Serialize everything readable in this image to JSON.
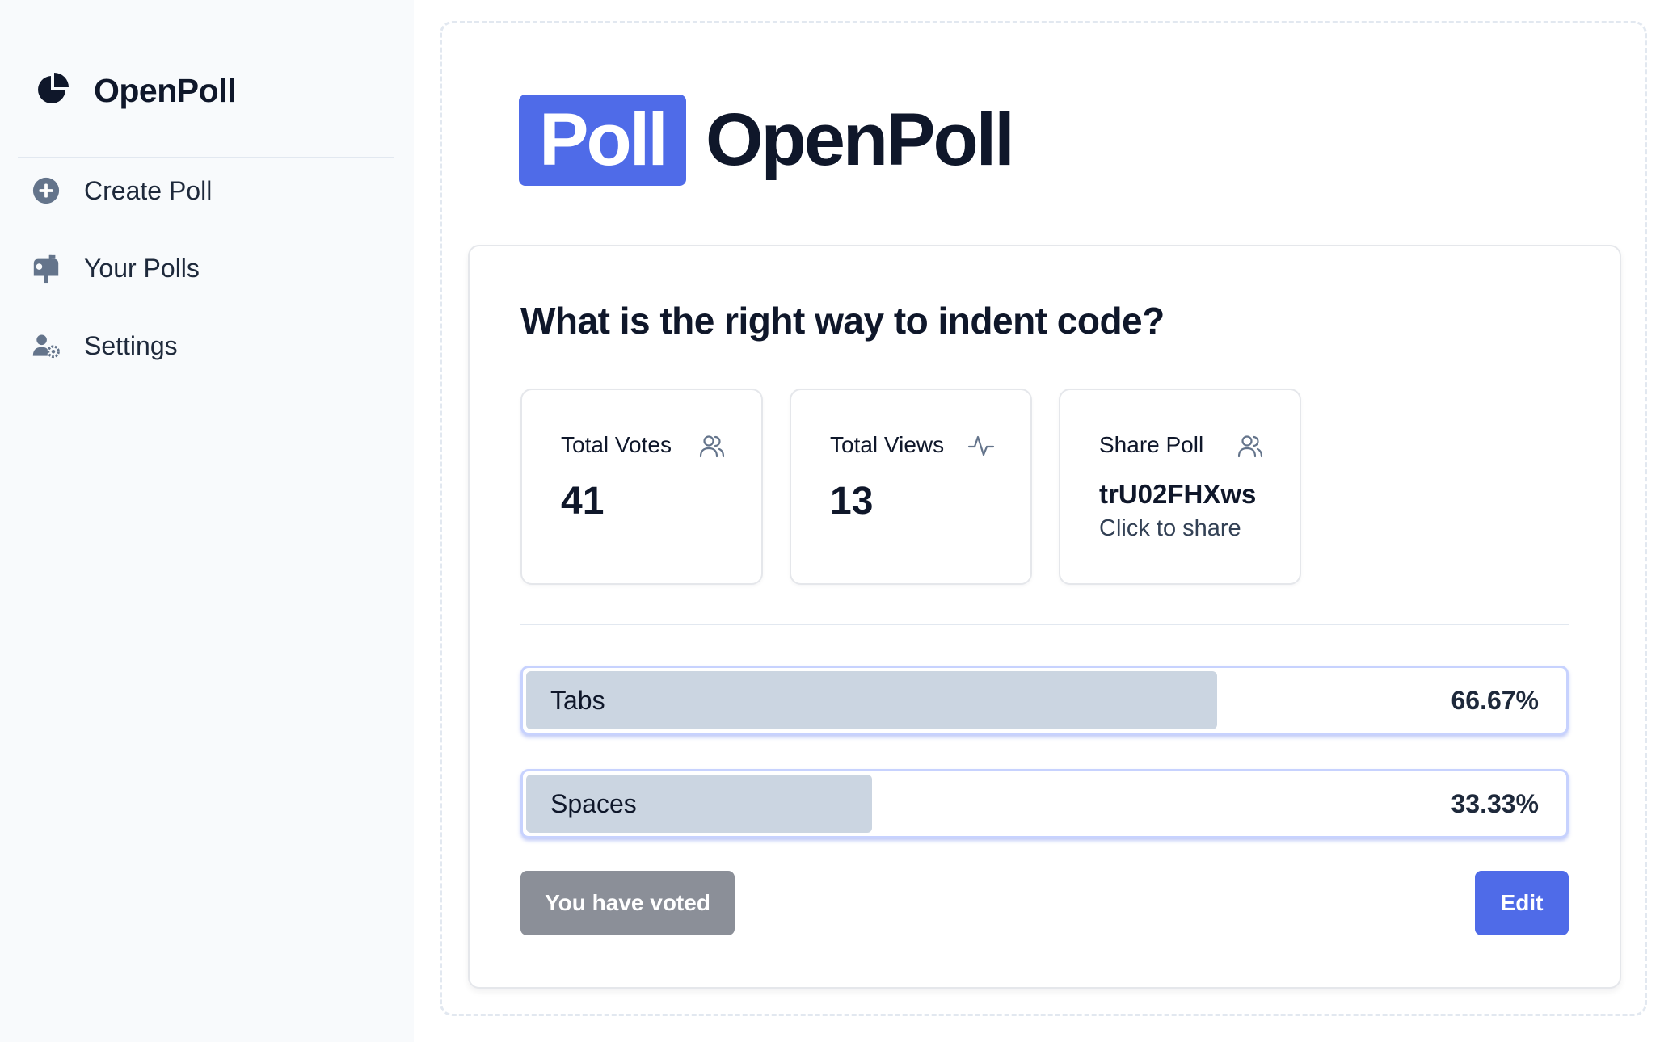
{
  "sidebar": {
    "brand": "OpenPoll",
    "items": [
      {
        "label": "Create Poll",
        "icon": "plus-circle-icon"
      },
      {
        "label": "Your Polls",
        "icon": "mailbox-icon"
      },
      {
        "label": "Settings",
        "icon": "user-cog-icon"
      }
    ]
  },
  "header": {
    "logo_badge": "Poll",
    "logo_text": "OpenPoll"
  },
  "poll": {
    "question": "What is the right way to indent code?",
    "stats": {
      "votes": {
        "label": "Total Votes",
        "value": "41",
        "icon": "users-icon"
      },
      "views": {
        "label": "Total Views",
        "value": "13",
        "icon": "activity-icon"
      },
      "share": {
        "label": "Share Poll",
        "code": "trU02FHXws",
        "sub": "Click to share",
        "icon": "users-icon"
      }
    },
    "options": [
      {
        "label": "Tabs",
        "percent_text": "66.67%",
        "fraction": 0.6667
      },
      {
        "label": "Spaces",
        "percent_text": "33.33%",
        "fraction": 0.3333
      }
    ],
    "voted_label": "You have voted",
    "edit_label": "Edit"
  },
  "colors": {
    "accent": "#4f6be8",
    "bar_fill": "#cbd5e1",
    "sidebar_bg": "#f8fafc"
  }
}
